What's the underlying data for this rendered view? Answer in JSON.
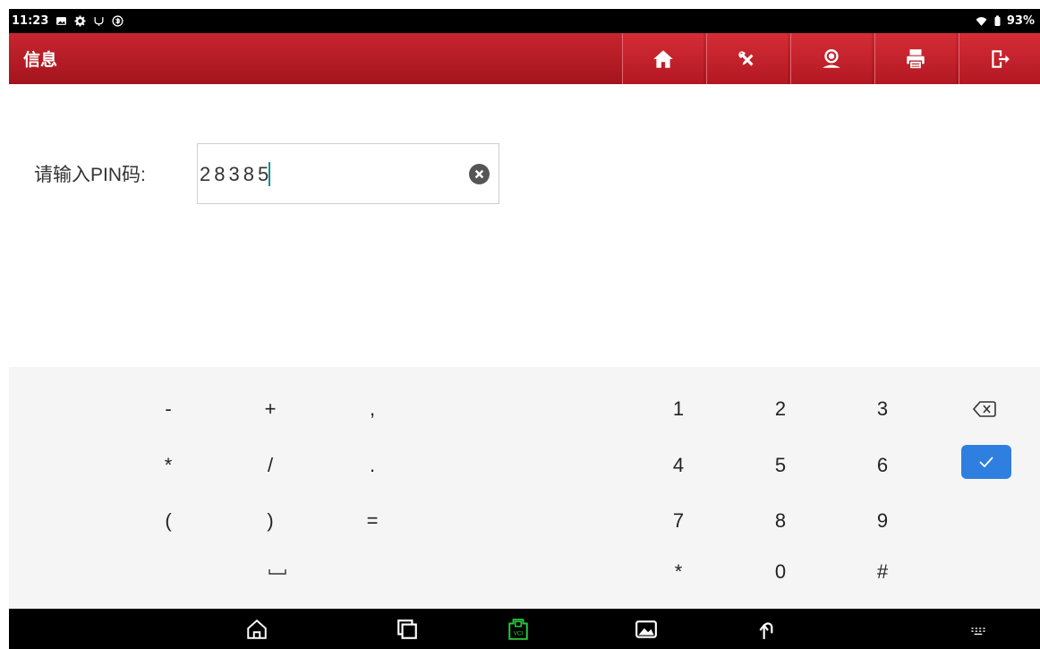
{
  "status_bar": {
    "time": "11:23",
    "battery": "93%"
  },
  "header": {
    "title": "信息"
  },
  "toolbar": [
    "home-icon",
    "tools-icon",
    "support-icon",
    "print-icon",
    "exit-icon"
  ],
  "form": {
    "label": "请输入PIN码:",
    "value": "28385"
  },
  "keyboard": {
    "symbols": [
      "-",
      "+",
      ",",
      "*",
      "/",
      ".",
      "(",
      ")",
      "="
    ],
    "digits": [
      "1",
      "2",
      "3",
      "4",
      "5",
      "6",
      "7",
      "8",
      "9",
      "*",
      "0",
      "#"
    ]
  },
  "colors": {
    "header_red": "#b81c26",
    "confirm_blue": "#2f7fe0",
    "caret_teal": "#0b8c8c",
    "vci_green": "#27c93a"
  }
}
